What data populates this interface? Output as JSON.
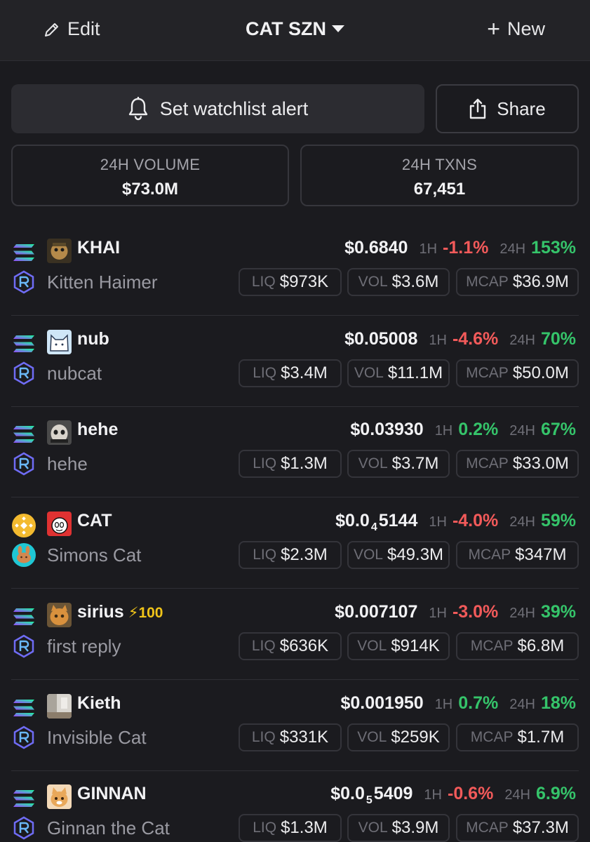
{
  "header": {
    "edit_label": "Edit",
    "title": "CAT SZN",
    "new_label": "New"
  },
  "actions": {
    "alert_label": "Set watchlist alert",
    "share_label": "Share"
  },
  "stats": {
    "volume_label": "24H VOLUME",
    "volume_value": "$73.0M",
    "txns_label": "24H TXNS",
    "txns_value": "67,451"
  },
  "labels": {
    "tf_1h": "1H",
    "tf_24h": "24H",
    "liq": "LIQ",
    "vol": "VOL",
    "mcap": "MCAP"
  },
  "colors": {
    "positive": "#35c46a",
    "negative": "#f25a5a",
    "boost": "#f0c419"
  },
  "tokens": [
    {
      "ticker": "KHAI",
      "name": "Kitten Haimer",
      "chain": "solana-icon",
      "dex": "raydium-icon",
      "price_main": "$0.6840",
      "price_sub": "",
      "price_tail": "",
      "h1": "-1.1%",
      "h24": "153%",
      "liq": "$973K",
      "vol": "$3.6M",
      "mcap": "$36.9M",
      "boost": ""
    },
    {
      "ticker": "nub",
      "name": "nubcat",
      "chain": "solana-icon",
      "dex": "raydium-icon",
      "price_main": "$0.05008",
      "price_sub": "",
      "price_tail": "",
      "h1": "-4.6%",
      "h24": "70%",
      "liq": "$3.4M",
      "vol": "$11.1M",
      "mcap": "$50.0M",
      "boost": ""
    },
    {
      "ticker": "hehe",
      "name": "hehe",
      "chain": "solana-icon",
      "dex": "raydium-icon",
      "price_main": "$0.03930",
      "price_sub": "",
      "price_tail": "",
      "h1": "0.2%",
      "h24": "67%",
      "liq": "$1.3M",
      "vol": "$3.7M",
      "mcap": "$33.0M",
      "boost": ""
    },
    {
      "ticker": "CAT",
      "name": "Simons Cat",
      "chain": "bnb-icon",
      "dex": "pancakeswap-icon",
      "price_main": "$0.0",
      "price_sub": "4",
      "price_tail": "5144",
      "h1": "-4.0%",
      "h24": "59%",
      "liq": "$2.3M",
      "vol": "$49.3M",
      "mcap": "$347M",
      "boost": ""
    },
    {
      "ticker": "sirius",
      "name": "first reply",
      "chain": "solana-icon",
      "dex": "raydium-icon",
      "price_main": "$0.007107",
      "price_sub": "",
      "price_tail": "",
      "h1": "-3.0%",
      "h24": "39%",
      "liq": "$636K",
      "vol": "$914K",
      "mcap": "$6.8M",
      "boost": "⚡100"
    },
    {
      "ticker": "Kieth",
      "name": "Invisible Cat",
      "chain": "solana-icon",
      "dex": "raydium-icon",
      "price_main": "$0.001950",
      "price_sub": "",
      "price_tail": "",
      "h1": "0.7%",
      "h24": "18%",
      "liq": "$331K",
      "vol": "$259K",
      "mcap": "$1.7M",
      "boost": ""
    },
    {
      "ticker": "GINNAN",
      "name": "Ginnan the Cat",
      "chain": "solana-icon",
      "dex": "raydium-icon",
      "price_main": "$0.0",
      "price_sub": "5",
      "price_tail": "5409",
      "h1": "-0.6%",
      "h24": "6.9%",
      "liq": "$1.3M",
      "vol": "$3.9M",
      "mcap": "$37.3M",
      "boost": ""
    }
  ]
}
